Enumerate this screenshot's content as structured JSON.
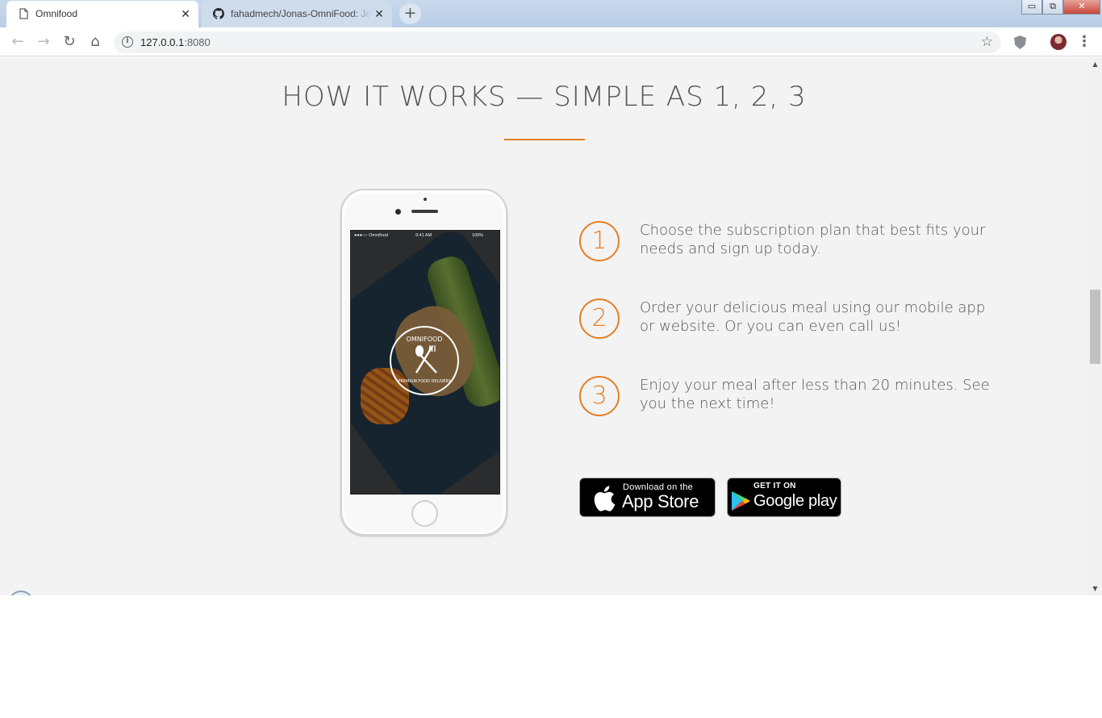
{
  "browser": {
    "tabs": [
      {
        "title": "Omnifood",
        "active": true,
        "icon": "page-icon"
      },
      {
        "title": "fahadmech/Jonas-OmniFood: Jonas",
        "active": false,
        "icon": "github-icon"
      }
    ],
    "new_tab_symbol": "+",
    "window_controls": {
      "minimize": "▭",
      "restore": "⧉",
      "close": "✕"
    },
    "url_host": "127.0.0.1",
    "url_port": ":8080",
    "nav": {
      "back": "←",
      "forward": "→",
      "reload": "↻",
      "home": "⌂"
    },
    "star": "☆",
    "menu": "⋮"
  },
  "section": {
    "title": "HOW IT WORKS — SIMPLE AS 1, 2, 3",
    "steps": [
      {
        "number": "1",
        "text": "Choose the subscription plan that best fits your needs and sign up today."
      },
      {
        "number": "2",
        "text": "Order your delicious meal using our mobile app or website. Or you can even call us!"
      },
      {
        "number": "3",
        "text": "Enjoy your meal after less than 20 minutes. See you the next time!"
      }
    ]
  },
  "phone": {
    "status_carrier": "●●●○○ Omnifood",
    "status_time": "9:41 AM",
    "status_battery": "100%",
    "logo_brand": "OMNIFOOD",
    "logo_tagline": "PREMIUM FOOD DELIVERY"
  },
  "app_badges": {
    "apple_small": "Download on the",
    "apple_big": "App Store",
    "google_small": "GET IT ON",
    "google_big": "Google play"
  },
  "colors": {
    "accent": "#e67e22",
    "text": "#555555",
    "background": "#f3f3f3"
  }
}
